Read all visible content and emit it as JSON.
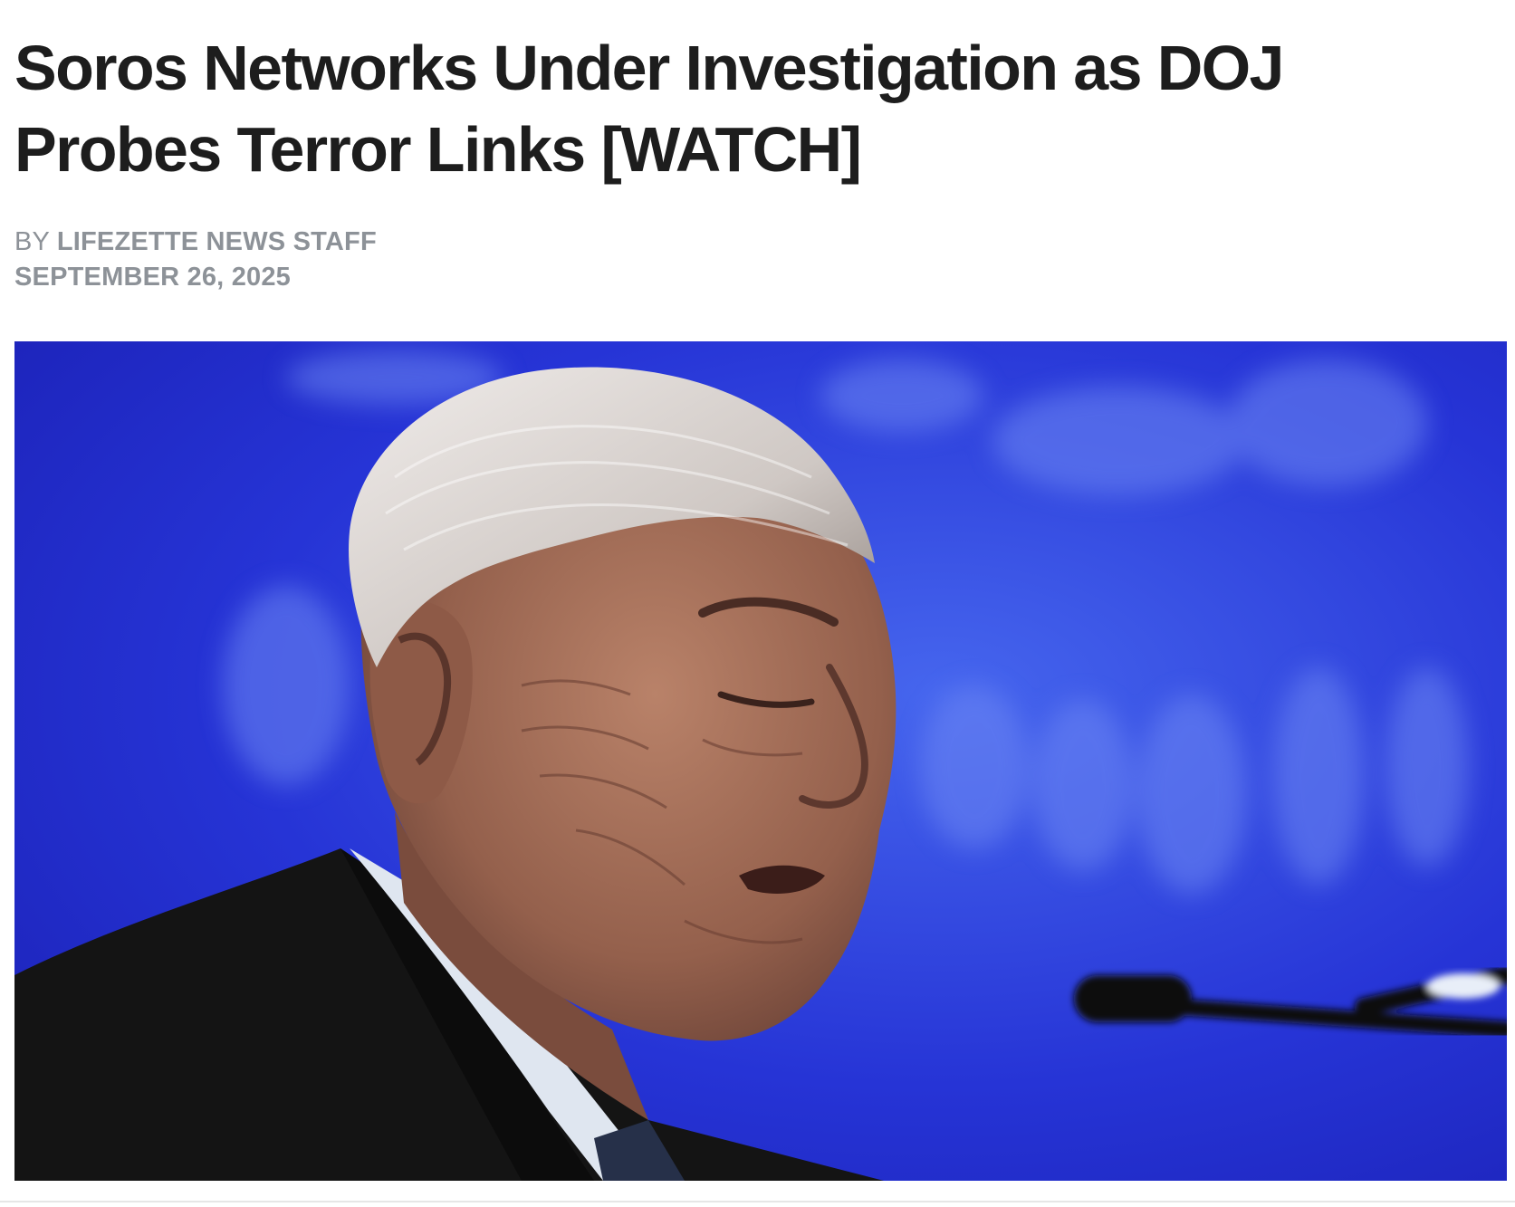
{
  "article": {
    "headline": "Soros Networks Under Investigation as DOJ Probes Terror Links [WATCH]",
    "byline_prefix": "BY",
    "author": "LIFEZETTE NEWS STAFF",
    "date": "SEPTEMBER 26, 2025"
  },
  "hero_image": {
    "description_icon": "photo-of-elderly-man-speaking-at-microphone",
    "colors": {
      "background": "#1f26c9",
      "background_light": "#3f58e8",
      "suit": "#151515",
      "skin": "#9c6a55",
      "hair": "#d9d5d2"
    }
  },
  "colors": {
    "headline": "#1d1d1d",
    "meta": "#8d9298",
    "page_background": "#ffffff"
  }
}
